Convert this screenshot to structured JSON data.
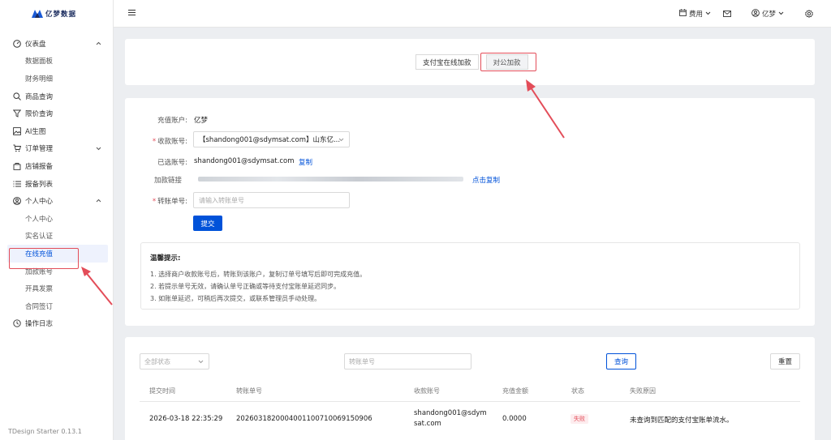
{
  "app": {
    "brand": "亿梦数据",
    "version": "TDesign Starter 0.13.1"
  },
  "sidebar": {
    "items": [
      {
        "label": "仪表盘",
        "icon": "dashboard-icon",
        "group": true,
        "expanded": true
      },
      {
        "label": "数据面板",
        "sub": true
      },
      {
        "label": "财务明细",
        "sub": true
      },
      {
        "label": "商品查询",
        "icon": "search-icon"
      },
      {
        "label": "限价查询",
        "icon": "filter-icon"
      },
      {
        "label": "AI生图",
        "icon": "image-icon"
      },
      {
        "label": "订单管理",
        "icon": "cart-icon",
        "group": true,
        "expanded": false
      },
      {
        "label": "店铺报备",
        "icon": "shop-icon"
      },
      {
        "label": "报备列表",
        "icon": "list-icon"
      },
      {
        "label": "个人中心",
        "icon": "user-circle-icon",
        "group": true,
        "expanded": true
      },
      {
        "label": "个人中心",
        "sub": true
      },
      {
        "label": "实名认证",
        "sub": true
      },
      {
        "label": "在线充值",
        "sub": true,
        "active": true
      },
      {
        "label": "加款账号",
        "sub": true
      },
      {
        "label": "开具发票",
        "sub": true
      },
      {
        "label": "合同签订",
        "sub": true
      },
      {
        "label": "操作日志",
        "icon": "history-icon"
      }
    ]
  },
  "topbar": {
    "fee_label": "费用",
    "user_label": "亿梦"
  },
  "tabs": {
    "alipay": "支付宝在线加款",
    "corporate": "对公加款"
  },
  "form": {
    "account_label": "充值账户:",
    "account_value": "亿梦",
    "receiver_label": "收款账号:",
    "receiver_value": "【shandong001@sdymsat.com】山东亿...",
    "selected_label": "已选账号:",
    "selected_value": "shandong001@sdymsat.com",
    "copy_label": "复制",
    "link_label": "加款链接",
    "link_copy_label": "点击复制",
    "transfer_label": "转账单号:",
    "transfer_placeholder": "请输入转账单号",
    "submit_label": "提交"
  },
  "tips": {
    "title": "温馨提示:",
    "lines": [
      "1. 选择商户收款账号后，转账到该账户，复制订单号填写后即可完成充值。",
      "2. 若提示单号无效，请确认单号正确或等待支付宝账单延迟同步。",
      "3. 如账单延迟，可稍后再次提交，或联系管理员手动处理。"
    ]
  },
  "filter": {
    "status_placeholder": "全部状态",
    "transfer_placeholder": "转账单号",
    "query_label": "查询",
    "reset_label": "重置"
  },
  "table": {
    "headers": [
      "提交时间",
      "转账单号",
      "收款账号",
      "充值金额",
      "状态",
      "失败原因"
    ],
    "rows": [
      {
        "time": "2026-03-18 22:35:29",
        "transfer_no": "2026031820004001100710069150906",
        "account_line1": "shandong001@sdym",
        "account_line2": "sat.com",
        "amount": "0.0000",
        "status": "失败",
        "reason": "未查询到匹配的支付宝账单流水。"
      }
    ]
  },
  "colors": {
    "primary": "#0052d9",
    "danger": "#e34d59",
    "annotation": "#e34d59"
  }
}
